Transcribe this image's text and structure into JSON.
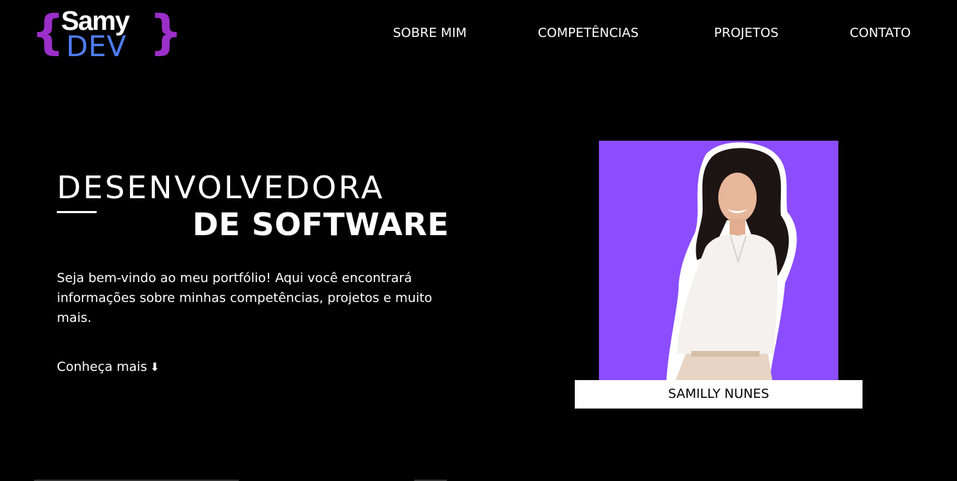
{
  "logo": {
    "brace_left": "{",
    "brace_right": "}",
    "top_text": "Samy",
    "bottom_text": "DEV"
  },
  "nav": {
    "items": [
      {
        "label": "SOBRE MIM"
      },
      {
        "label": "COMPETÊNCIAS"
      },
      {
        "label": "PROJETOS"
      },
      {
        "label": "CONTATO"
      }
    ]
  },
  "hero": {
    "title_line1": "DESENVOLVEDORA",
    "title_line2": "DE SOFTWARE",
    "description": "Seja bem-vindo ao meu portfólio! Aqui você encontrará informações sobre minhas competências, projetos e muito mais.",
    "cta_label": "Conheça mais",
    "cta_icon": "⬇"
  },
  "profile": {
    "name": "SAMILLY NUNES",
    "photo_icon": "portrait-photo"
  },
  "colors": {
    "background": "#000000",
    "brace": "#9b2fc9",
    "dev": "#4f7cf0",
    "photo_bg": "#8b4dfd"
  }
}
